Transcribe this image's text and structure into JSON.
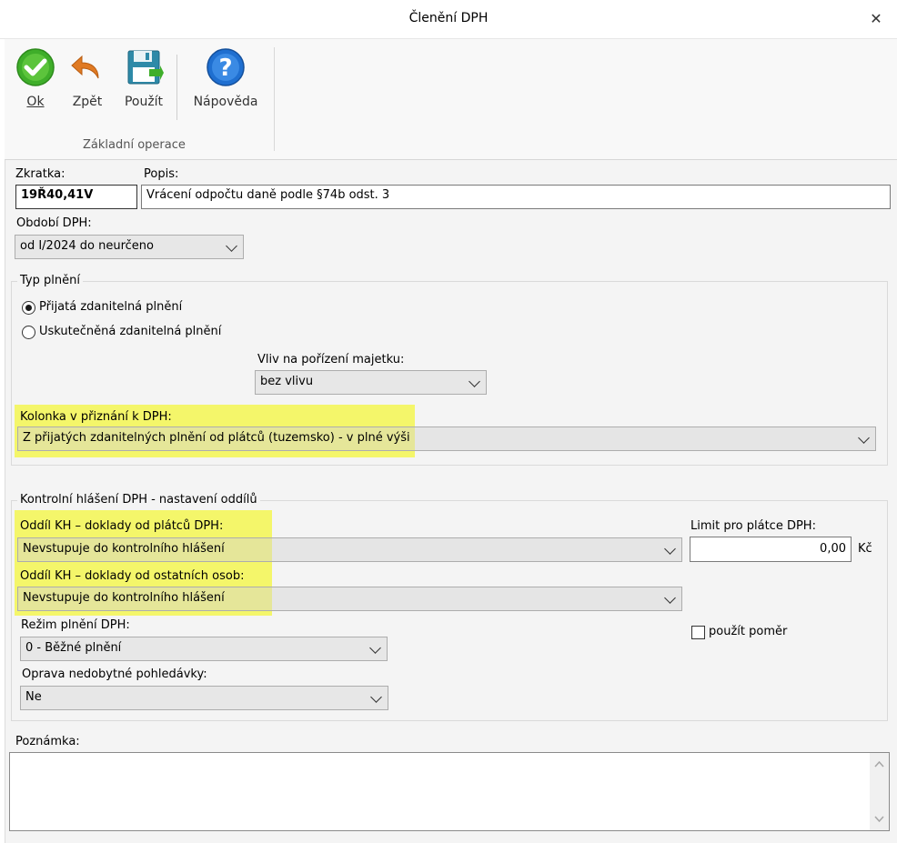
{
  "window": {
    "title": "Členění DPH",
    "close_glyph": "✕"
  },
  "toolbar": {
    "ok_label": "Ok",
    "back_label": "Zpět",
    "apply_label": "Použít",
    "help_label": "Nápověda",
    "group_label": "Základní operace"
  },
  "form": {
    "zkratka_label": "Zkratka:",
    "zkratka_value": "19Ř40,41V",
    "popis_label": "Popis:",
    "popis_value": "Vrácení odpočtu daně podle §74b odst. 3",
    "obdobi_label": "Období DPH:",
    "obdobi_value": "od I/2024 do neurčeno"
  },
  "typ_plneni": {
    "legend": "Typ plnění",
    "radio1_label": "Přijatá zdanitelná plnění",
    "radio2_label": "Uskutečněná zdanitelná plnění",
    "selected": "radio1",
    "vliv_label": "Vliv na pořízení majetku:",
    "vliv_value": "bez vlivu",
    "kolonka_label": "Kolonka v přiznání k DPH:",
    "kolonka_value": "Z přijatých zdanitelných plnění od plátců (tuzemsko) - v plné výši"
  },
  "kontrolni": {
    "legend": "Kontrolní hlášení DPH - nastavení oddílů",
    "oddil_platcu_label": "Oddíl KH – doklady od plátců DPH:",
    "oddil_platcu_value": "Nevstupuje do kontrolního hlášení",
    "limit_label": "Limit pro plátce DPH:",
    "limit_value": "0,00",
    "limit_unit": "Kč",
    "oddil_ostatnich_label": "Oddíl KH – doklady od ostatních osob:",
    "oddil_ostatnich_value": "Nevstupuje do kontrolního hlášení",
    "pomer_label": "použít poměr",
    "rezim_label": "Režim plnění DPH:",
    "rezim_value": "0 - Běžné plnění",
    "oprava_label": "Oprava nedobytné pohledávky:",
    "oprava_value": "Ne"
  },
  "poznamka": {
    "label": "Poznámka:",
    "value": ""
  },
  "colors": {
    "highlight": "#f4f66a",
    "help_blue": "#1f6fd0",
    "ok_green": "#3fae2a",
    "back_orange": "#e07a23",
    "save_teal": "#2e8aa8"
  }
}
